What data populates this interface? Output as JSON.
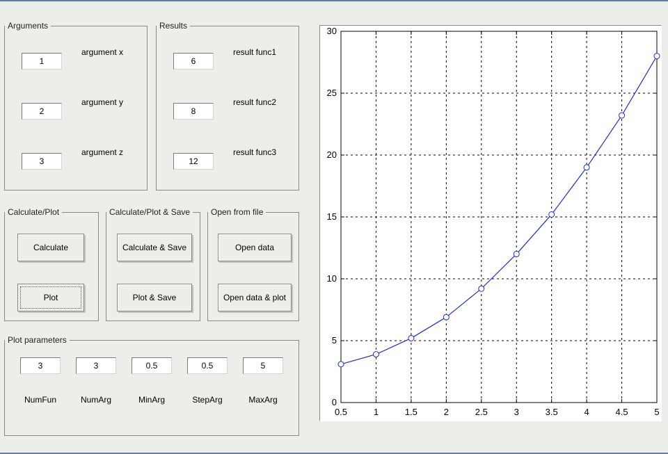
{
  "groups": {
    "arguments": {
      "legend": "Arguments",
      "rows": [
        {
          "value": "1",
          "label": "argument x"
        },
        {
          "value": "2",
          "label": "argument y"
        },
        {
          "value": "3",
          "label": "argument z"
        }
      ]
    },
    "results": {
      "legend": "Results",
      "rows": [
        {
          "value": "6",
          "label": "result func1"
        },
        {
          "value": "8",
          "label": "result func2"
        },
        {
          "value": "12",
          "label": "result func3"
        }
      ]
    },
    "calcplot": {
      "legend": "Calculate/Plot",
      "btn1": "Calculate",
      "btn2": "Plot"
    },
    "calcsave": {
      "legend": "Calculate/Plot & Save",
      "btn1": "Calculate & Save",
      "btn2": "Plot & Save"
    },
    "openfile": {
      "legend": "Open from file",
      "btn1": "Open data",
      "btn2": "Open data & plot"
    },
    "plotparams": {
      "legend": "Plot parameters",
      "cols": [
        {
          "value": "3",
          "label": "NumFun"
        },
        {
          "value": "3",
          "label": "NumArg"
        },
        {
          "value": "0.5",
          "label": "MinArg"
        },
        {
          "value": "0.5",
          "label": "StepArg"
        },
        {
          "value": "5",
          "label": "MaxArg"
        }
      ]
    }
  },
  "chart_data": {
    "type": "line",
    "x": [
      0.5,
      1,
      1.5,
      2,
      2.5,
      3,
      3.5,
      4,
      4.5,
      5
    ],
    "values": [
      3.1,
      3.9,
      5.2,
      6.9,
      9.2,
      12,
      15.2,
      19,
      23.2,
      28
    ],
    "markers": "o",
    "xlim": [
      0.5,
      5
    ],
    "ylim": [
      0,
      30
    ],
    "xticks": [
      0.5,
      1,
      1.5,
      2,
      2.5,
      3,
      3.5,
      4,
      4.5,
      5
    ],
    "yticks": [
      0,
      5,
      10,
      15,
      20,
      25,
      30
    ],
    "grid": true,
    "title": "",
    "xlabel": "",
    "ylabel": ""
  }
}
